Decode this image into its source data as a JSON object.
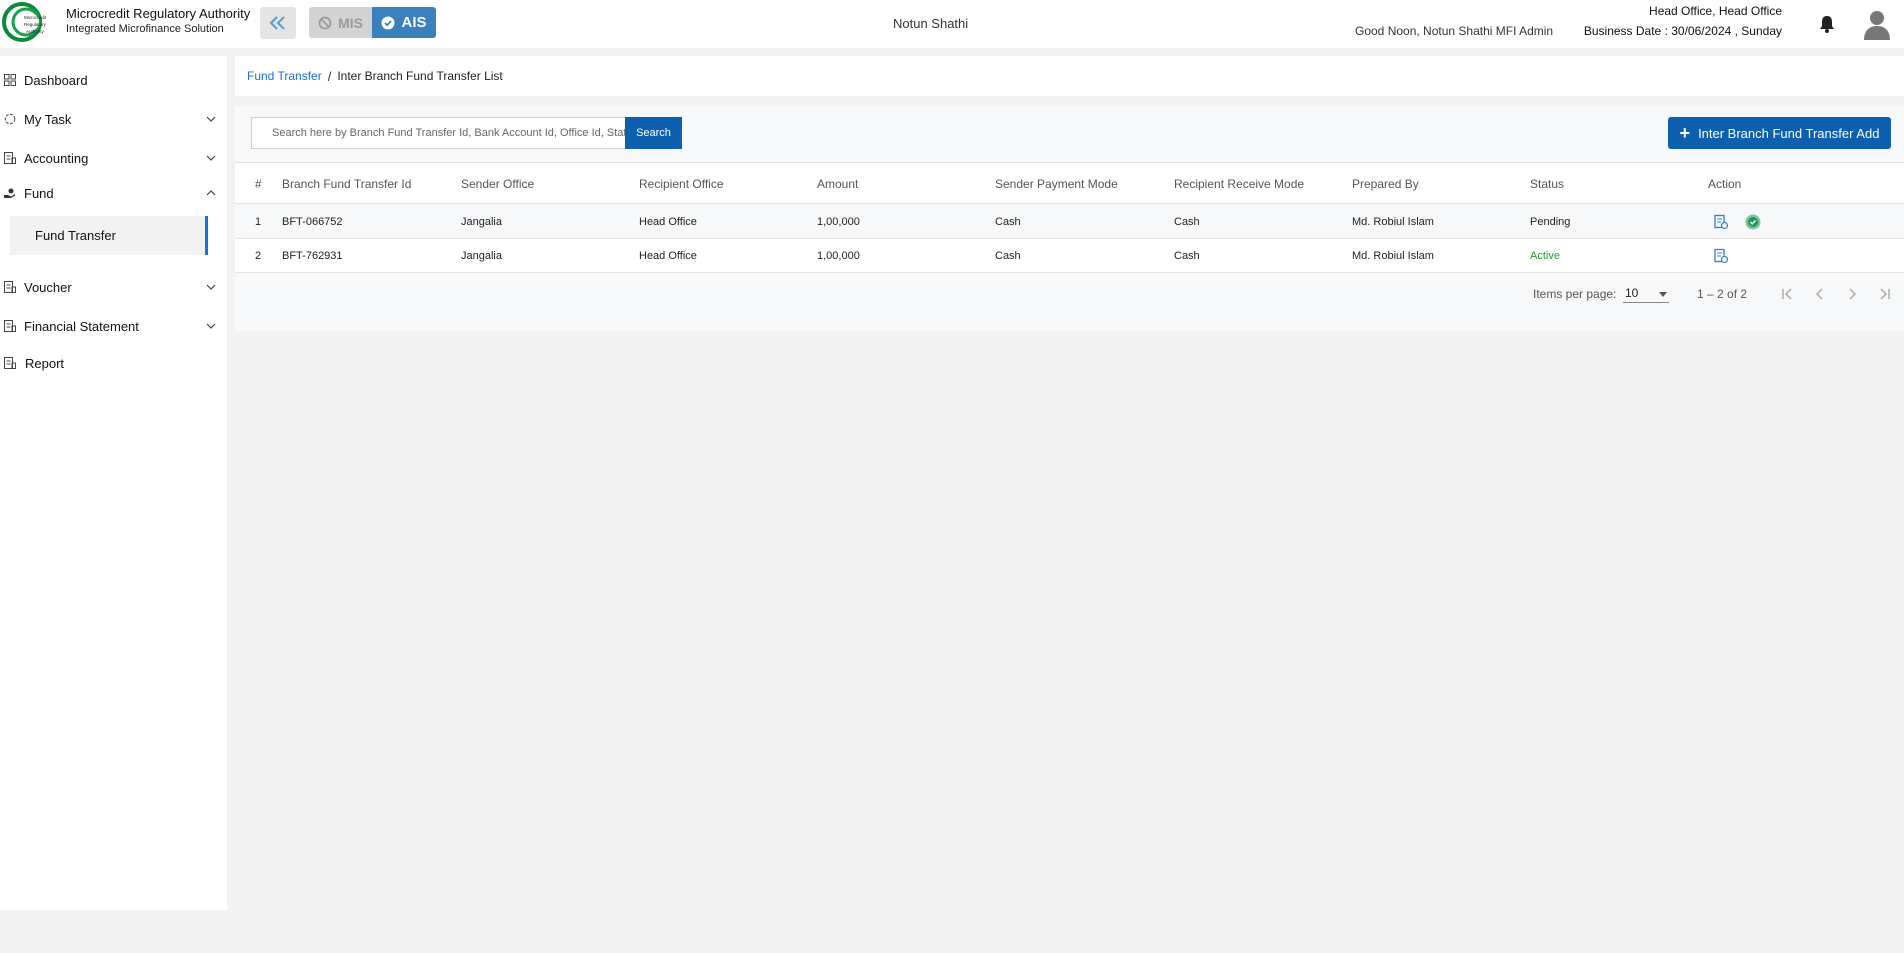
{
  "header": {
    "logo_text": "Microcredit Regulatory Authority",
    "brand_title": "Microcredit Regulatory Authority",
    "brand_subtitle": "Integrated Microfinance Solution",
    "mis_label": "MIS",
    "ais_label": "AIS",
    "org_name": "Notun Shathi",
    "greeting": "Good Noon, Notun Shathi MFI Admin",
    "office": "Head Office, Head Office",
    "business_date": "Business Date : 30/06/2024 , Sunday",
    "accent_color": "#3a80bd"
  },
  "sidebar": {
    "items": [
      {
        "label": "Dashboard",
        "icon": "grid-icon",
        "has_chevron": false
      },
      {
        "label": "My Task",
        "icon": "task-icon",
        "has_chevron": true
      },
      {
        "label": "Accounting",
        "icon": "document-icon",
        "has_chevron": true
      },
      {
        "label": "Fund",
        "icon": "hand-money-icon",
        "has_chevron": true,
        "expanded": true
      },
      {
        "label": "Voucher",
        "icon": "document-icon",
        "has_chevron": true
      },
      {
        "label": "Financial Statement",
        "icon": "document-icon",
        "has_chevron": true
      },
      {
        "label": "Report",
        "icon": "document-icon",
        "has_chevron": false
      }
    ],
    "sub_items": [
      {
        "label": "Fund Transfer",
        "active": true
      }
    ]
  },
  "breadcrumb": {
    "parent": "Fund Transfer",
    "separator": "/",
    "current": "Inter Branch Fund Transfer List"
  },
  "toolbar": {
    "search_placeholder": "Search here by Branch Fund Transfer Id, Bank Account Id, Office Id, Status",
    "search_label": "Search",
    "add_label": "Inter Branch Fund Transfer Add"
  },
  "table": {
    "columns": [
      "#",
      "Branch Fund Transfer Id",
      "Sender Office",
      "Recipient Office",
      "Amount",
      "Sender Payment Mode",
      "Recipient Receive Mode",
      "Prepared By",
      "Status",
      "Action"
    ],
    "rows": [
      {
        "no": "1",
        "id": "BFT-066752",
        "sender": "Jangalia",
        "recipient": "Head Office",
        "amount": "1,00,000",
        "sender_mode": "Cash",
        "recipient_mode": "Cash",
        "prepared_by": "Md. Robiul Islam",
        "status": "Pending"
      },
      {
        "no": "2",
        "id": "BFT-762931",
        "sender": "Jangalia",
        "recipient": "Head Office",
        "amount": "1,00,000",
        "sender_mode": "Cash",
        "recipient_mode": "Cash",
        "prepared_by": "Md. Robiul Islam",
        "status": "Active"
      }
    ]
  },
  "pager": {
    "items_per_page_label": "Items per page:",
    "items_per_page": "10",
    "range": "1 – 2 of 2"
  }
}
